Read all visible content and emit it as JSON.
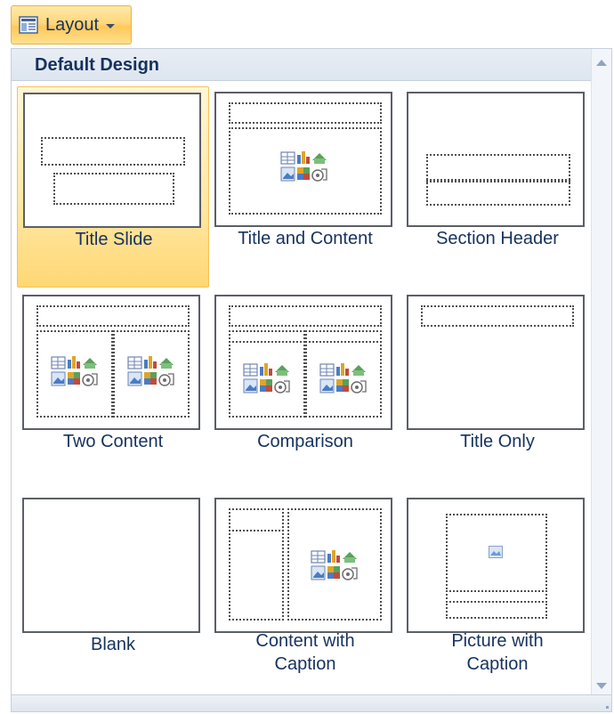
{
  "ribbon": {
    "layout_button": {
      "label": "Layout",
      "icon": "layout-icon"
    }
  },
  "gallery": {
    "header": "Default Design",
    "items": [
      {
        "label": "Title Slide",
        "selected": true
      },
      {
        "label": "Title and Content"
      },
      {
        "label": "Section Header"
      },
      {
        "label": "Two Content"
      },
      {
        "label": "Comparison"
      },
      {
        "label": "Title Only"
      },
      {
        "label": "Blank"
      },
      {
        "label_line1": "Content with",
        "label_line2": "Caption"
      },
      {
        "label_line1": "Picture with",
        "label_line2": "Caption"
      }
    ]
  },
  "colors": {
    "selected_bg": "#ffe7a3",
    "selected_border": "#f3c15b",
    "label_text": "#15325f",
    "thumb_border": "#5b5f66"
  }
}
